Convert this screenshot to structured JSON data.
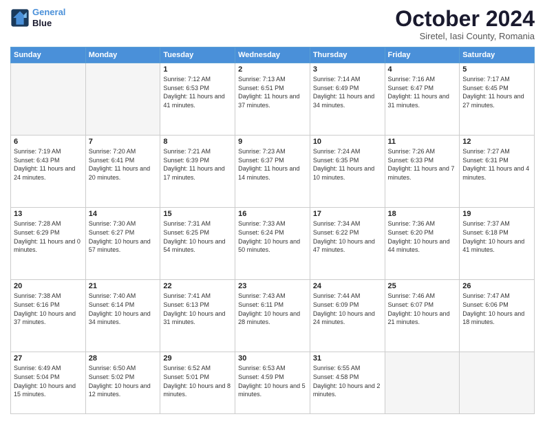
{
  "header": {
    "logo_line1": "General",
    "logo_line2": "Blue",
    "month": "October 2024",
    "location": "Siretel, Iasi County, Romania"
  },
  "weekdays": [
    "Sunday",
    "Monday",
    "Tuesday",
    "Wednesday",
    "Thursday",
    "Friday",
    "Saturday"
  ],
  "weeks": [
    [
      {
        "day": "",
        "content": ""
      },
      {
        "day": "",
        "content": ""
      },
      {
        "day": "1",
        "content": "Sunrise: 7:12 AM\nSunset: 6:53 PM\nDaylight: 11 hours and 41 minutes."
      },
      {
        "day": "2",
        "content": "Sunrise: 7:13 AM\nSunset: 6:51 PM\nDaylight: 11 hours and 37 minutes."
      },
      {
        "day": "3",
        "content": "Sunrise: 7:14 AM\nSunset: 6:49 PM\nDaylight: 11 hours and 34 minutes."
      },
      {
        "day": "4",
        "content": "Sunrise: 7:16 AM\nSunset: 6:47 PM\nDaylight: 11 hours and 31 minutes."
      },
      {
        "day": "5",
        "content": "Sunrise: 7:17 AM\nSunset: 6:45 PM\nDaylight: 11 hours and 27 minutes."
      }
    ],
    [
      {
        "day": "6",
        "content": "Sunrise: 7:19 AM\nSunset: 6:43 PM\nDaylight: 11 hours and 24 minutes."
      },
      {
        "day": "7",
        "content": "Sunrise: 7:20 AM\nSunset: 6:41 PM\nDaylight: 11 hours and 20 minutes."
      },
      {
        "day": "8",
        "content": "Sunrise: 7:21 AM\nSunset: 6:39 PM\nDaylight: 11 hours and 17 minutes."
      },
      {
        "day": "9",
        "content": "Sunrise: 7:23 AM\nSunset: 6:37 PM\nDaylight: 11 hours and 14 minutes."
      },
      {
        "day": "10",
        "content": "Sunrise: 7:24 AM\nSunset: 6:35 PM\nDaylight: 11 hours and 10 minutes."
      },
      {
        "day": "11",
        "content": "Sunrise: 7:26 AM\nSunset: 6:33 PM\nDaylight: 11 hours and 7 minutes."
      },
      {
        "day": "12",
        "content": "Sunrise: 7:27 AM\nSunset: 6:31 PM\nDaylight: 11 hours and 4 minutes."
      }
    ],
    [
      {
        "day": "13",
        "content": "Sunrise: 7:28 AM\nSunset: 6:29 PM\nDaylight: 11 hours and 0 minutes."
      },
      {
        "day": "14",
        "content": "Sunrise: 7:30 AM\nSunset: 6:27 PM\nDaylight: 10 hours and 57 minutes."
      },
      {
        "day": "15",
        "content": "Sunrise: 7:31 AM\nSunset: 6:25 PM\nDaylight: 10 hours and 54 minutes."
      },
      {
        "day": "16",
        "content": "Sunrise: 7:33 AM\nSunset: 6:24 PM\nDaylight: 10 hours and 50 minutes."
      },
      {
        "day": "17",
        "content": "Sunrise: 7:34 AM\nSunset: 6:22 PM\nDaylight: 10 hours and 47 minutes."
      },
      {
        "day": "18",
        "content": "Sunrise: 7:36 AM\nSunset: 6:20 PM\nDaylight: 10 hours and 44 minutes."
      },
      {
        "day": "19",
        "content": "Sunrise: 7:37 AM\nSunset: 6:18 PM\nDaylight: 10 hours and 41 minutes."
      }
    ],
    [
      {
        "day": "20",
        "content": "Sunrise: 7:38 AM\nSunset: 6:16 PM\nDaylight: 10 hours and 37 minutes."
      },
      {
        "day": "21",
        "content": "Sunrise: 7:40 AM\nSunset: 6:14 PM\nDaylight: 10 hours and 34 minutes."
      },
      {
        "day": "22",
        "content": "Sunrise: 7:41 AM\nSunset: 6:13 PM\nDaylight: 10 hours and 31 minutes."
      },
      {
        "day": "23",
        "content": "Sunrise: 7:43 AM\nSunset: 6:11 PM\nDaylight: 10 hours and 28 minutes."
      },
      {
        "day": "24",
        "content": "Sunrise: 7:44 AM\nSunset: 6:09 PM\nDaylight: 10 hours and 24 minutes."
      },
      {
        "day": "25",
        "content": "Sunrise: 7:46 AM\nSunset: 6:07 PM\nDaylight: 10 hours and 21 minutes."
      },
      {
        "day": "26",
        "content": "Sunrise: 7:47 AM\nSunset: 6:06 PM\nDaylight: 10 hours and 18 minutes."
      }
    ],
    [
      {
        "day": "27",
        "content": "Sunrise: 6:49 AM\nSunset: 5:04 PM\nDaylight: 10 hours and 15 minutes."
      },
      {
        "day": "28",
        "content": "Sunrise: 6:50 AM\nSunset: 5:02 PM\nDaylight: 10 hours and 12 minutes."
      },
      {
        "day": "29",
        "content": "Sunrise: 6:52 AM\nSunset: 5:01 PM\nDaylight: 10 hours and 8 minutes."
      },
      {
        "day": "30",
        "content": "Sunrise: 6:53 AM\nSunset: 4:59 PM\nDaylight: 10 hours and 5 minutes."
      },
      {
        "day": "31",
        "content": "Sunrise: 6:55 AM\nSunset: 4:58 PM\nDaylight: 10 hours and 2 minutes."
      },
      {
        "day": "",
        "content": ""
      },
      {
        "day": "",
        "content": ""
      }
    ]
  ]
}
